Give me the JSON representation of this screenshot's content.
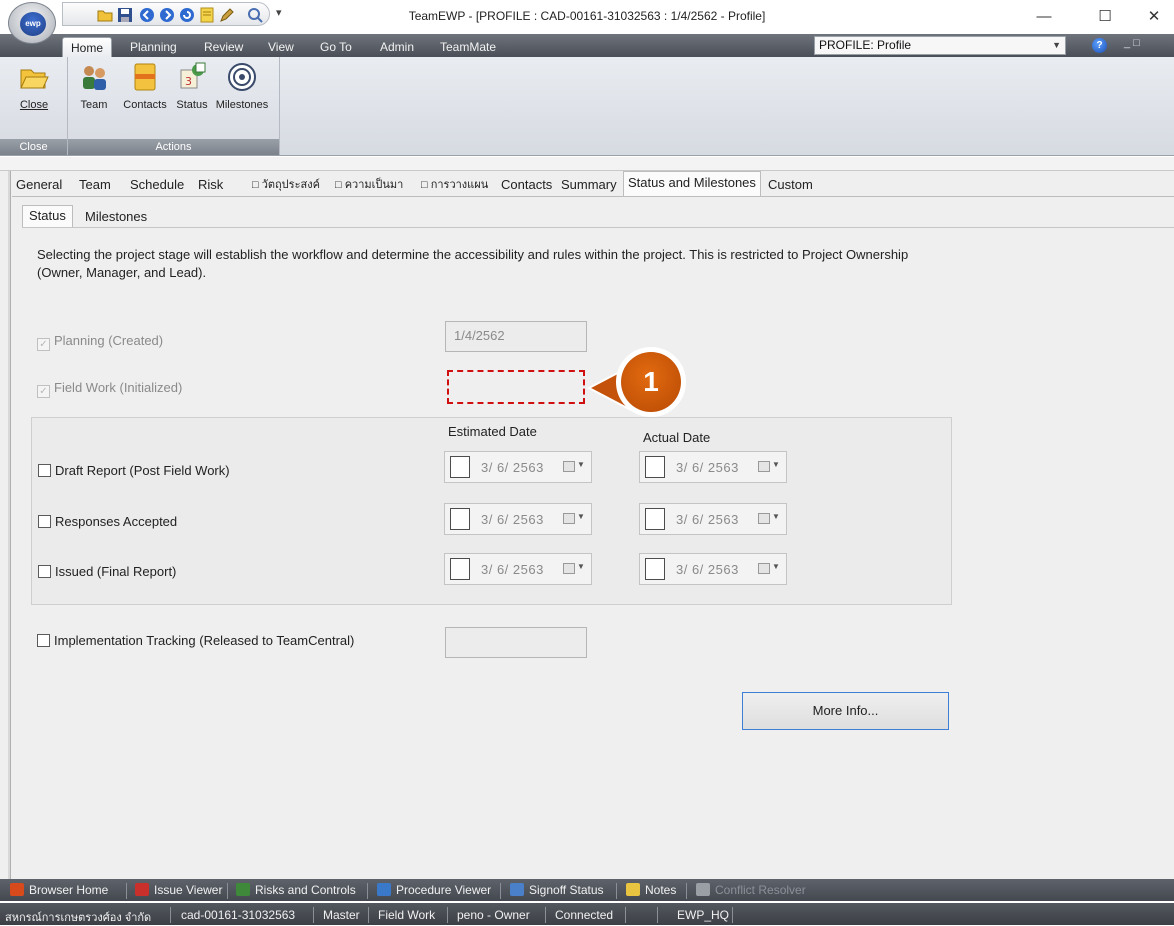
{
  "window": {
    "title": "TeamEWP - [PROFILE : CAD-00161-31032563 : 1/4/2562 - Profile]",
    "logo_text": "ewp",
    "qat_more": "▾",
    "controls": {
      "minimize": "—",
      "maximize": "☐",
      "close": "✕"
    }
  },
  "ribbon": {
    "tabs": [
      "Home",
      "Planning",
      "Review",
      "View",
      "Go To",
      "Admin",
      "TeamMate"
    ],
    "active_tab": "Home",
    "profile_select": "PROFILE: Profile",
    "help": "?",
    "mdi_controls": "_ □",
    "groups": [
      {
        "label": "Close",
        "buttons": [
          {
            "label": "Close",
            "icon": "folder-open-icon"
          }
        ]
      },
      {
        "label": "Actions",
        "buttons": [
          {
            "label": "Team",
            "icon": "team-icon"
          },
          {
            "label": "Contacts",
            "icon": "contacts-icon"
          },
          {
            "label": "Status",
            "icon": "status-icon"
          },
          {
            "label": "Milestones",
            "icon": "milestones-icon"
          }
        ]
      }
    ]
  },
  "form": {
    "main_tabs": [
      "General",
      "Team",
      "Schedule",
      "Risk",
      "□ วัตถุประสงค์",
      "□ ความเป็นมา",
      "□ การวางแผน",
      "Contacts",
      "Summary",
      "Status and Milestones",
      "Custom"
    ],
    "active_main_tab": "Status and Milestones",
    "sub_tabs": [
      "Status",
      "Milestones"
    ],
    "active_sub_tab": "Status",
    "description": "Selecting the project stage will establish the workflow and determine the accessibility and rules within the project.  This is restricted to Project Ownership (Owner, Manager, and Lead).",
    "planning": {
      "label": "Planning (Created)",
      "checked": true,
      "date": "1/4/2562"
    },
    "field_work": {
      "label": "Field Work (Initialized)",
      "checked": true,
      "date": ""
    },
    "callout_number": "1",
    "headers": {
      "estimated": "Estimated Date",
      "actual": "Actual Date"
    },
    "milestones": [
      {
        "label": "Draft Report (Post Field Work)",
        "estimated": "3/ 6/ 2563",
        "actual": "3/ 6/ 2563"
      },
      {
        "label": "Responses Accepted",
        "estimated": "3/ 6/ 2563",
        "actual": "3/ 6/ 2563"
      },
      {
        "label": "Issued (Final Report)",
        "estimated": "3/ 6/ 2563",
        "actual": "3/ 6/ 2563"
      }
    ],
    "implementation": {
      "label": "Implementation Tracking (Released to TeamCentral)",
      "date": ""
    },
    "more_info": "More Info..."
  },
  "nav_bar": [
    {
      "label": "Browser Home",
      "icon": "home-icon",
      "color": "#d64a1c",
      "disabled": false
    },
    {
      "label": "Issue Viewer",
      "icon": "issue-viewer-icon",
      "color": "#c9302c",
      "disabled": false
    },
    {
      "label": "Risks and Controls",
      "icon": "risks-icon",
      "color": "#3e8a3a",
      "disabled": false
    },
    {
      "label": "Procedure Viewer",
      "icon": "procedure-icon",
      "color": "#3a78c9",
      "disabled": false
    },
    {
      "label": "Signoff Status",
      "icon": "signoff-icon",
      "color": "#4a7fc9",
      "disabled": false
    },
    {
      "label": "Notes",
      "icon": "notes-icon",
      "color": "#e8c440",
      "disabled": false
    },
    {
      "label": "Conflict Resolver",
      "icon": "conflict-icon",
      "color": "#9a9ea5",
      "disabled": true
    }
  ],
  "status_bar": [
    "สหกรณ์การเกษตรวงศ์อง จำกัด",
    "cad-00161-31032563",
    "Master",
    "Field Work",
    "peno - Owner",
    "Connected",
    "",
    "EWP_HQ"
  ]
}
